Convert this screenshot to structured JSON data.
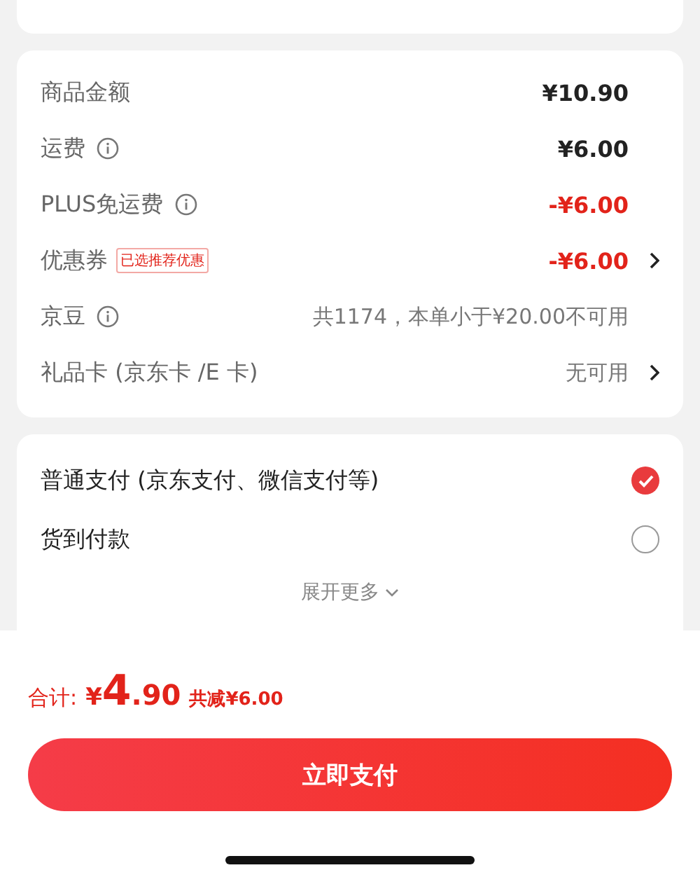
{
  "cost_rows": [
    {
      "label": "商品金额",
      "info": false,
      "value": "¥10.90",
      "kind": "normal",
      "chevron": false
    },
    {
      "label": "运费",
      "info": true,
      "value": "¥6.00",
      "kind": "normal",
      "chevron": false
    },
    {
      "label": "PLUS免运费",
      "info": true,
      "value": "-¥6.00",
      "kind": "discount",
      "chevron": false
    },
    {
      "label": "优惠券",
      "info": false,
      "tag": "已选推荐优惠",
      "value": "-¥6.00",
      "kind": "discount",
      "chevron": true
    },
    {
      "label": "京豆",
      "info": true,
      "value": "共1174，本单小于¥20.00不可用",
      "kind": "muted",
      "chevron": false
    },
    {
      "label": "礼品卡 (京东卡 /E 卡)",
      "info": false,
      "value": "无可用",
      "kind": "muted",
      "chevron": true
    }
  ],
  "payment_options": [
    {
      "label": "普通支付 (京东支付、微信支付等)",
      "selected": true
    },
    {
      "label": "货到付款",
      "selected": false
    }
  ],
  "expand_more": "展开更多",
  "total": {
    "label": "合计:",
    "symbol": "¥",
    "integer": "4",
    "decimal": ".90",
    "saving": "共减¥6.00"
  },
  "pay_button": "立即支付"
}
